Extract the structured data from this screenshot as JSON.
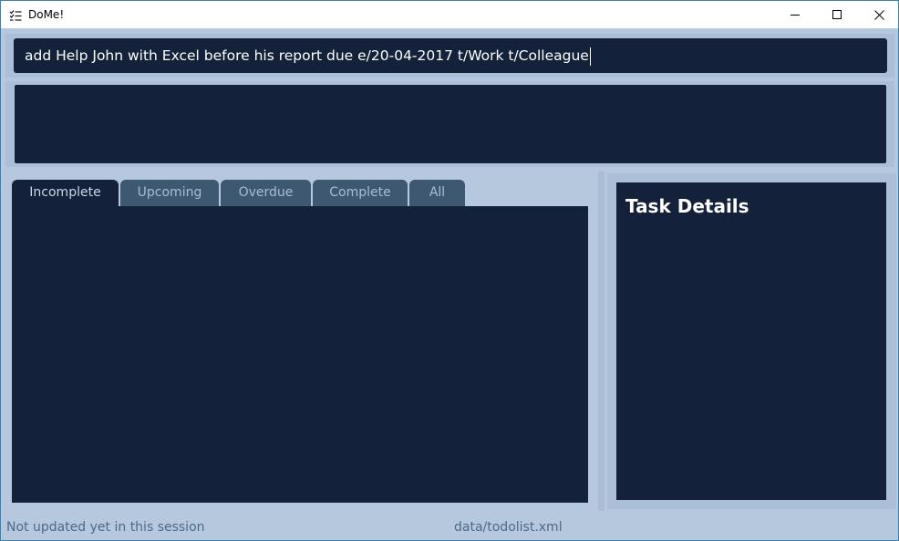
{
  "window": {
    "title": "DoMe!",
    "icon": "checklist-icon",
    "controls": {
      "minimize_icon": "minimize-icon",
      "maximize_icon": "maximize-icon",
      "close_icon": "close-icon"
    }
  },
  "command": {
    "value": "add Help John with Excel before his report due e/20-04-2017 t/Work t/Colleague"
  },
  "result": {
    "text": ""
  },
  "tabs": [
    {
      "label": "Incomplete",
      "active": true
    },
    {
      "label": "Upcoming",
      "active": false
    },
    {
      "label": "Overdue",
      "active": false
    },
    {
      "label": "Complete",
      "active": false
    },
    {
      "label": "All",
      "active": false
    }
  ],
  "details": {
    "title": "Task Details"
  },
  "status": {
    "sync": "Not updated yet in this session",
    "file": "data/todolist.xml"
  },
  "colors": {
    "background": "#b5c8dd",
    "panel_dark": "#13223a",
    "tab_inactive": "#3e5872",
    "status_text": "#4d6a89"
  }
}
